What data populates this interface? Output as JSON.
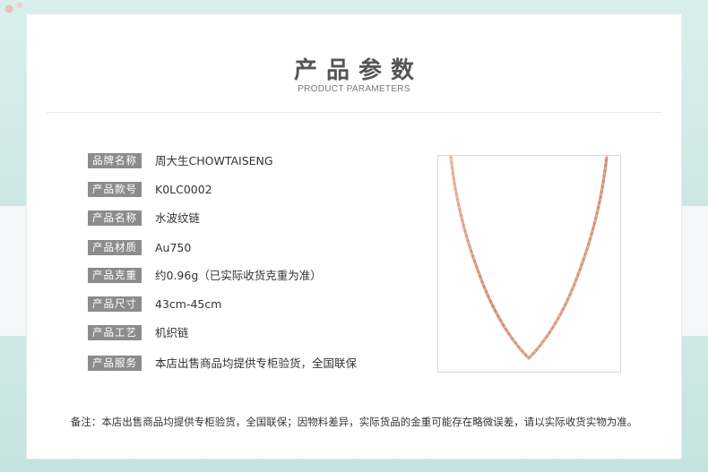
{
  "header": {
    "title_zh": "产品参数",
    "title_en": "PRODUCT PARAMETERS"
  },
  "params": [
    {
      "label": "品牌名称",
      "value": "周大生CHOWTAISENG"
    },
    {
      "label": "产品款号",
      "value": "K0LC0002"
    },
    {
      "label": "产品名称",
      "value": "水波纹链"
    },
    {
      "label": "产品材质",
      "value": "Au750"
    },
    {
      "label": "产品克重",
      "value": "约0.96g（已实际收货克重为准）"
    },
    {
      "label": "产品尺寸",
      "value": "43cm-45cm"
    },
    {
      "label": "产品工艺",
      "value": "机织链"
    },
    {
      "label": "产品服务",
      "value": "本店出售商品均提供专柜验货，全国联保"
    }
  ],
  "footnote": "备注：本店出售商品均提供专柜验货，全国联保；因物料差异，实际货品的金重可能存在略微误差，请以实际收货实物为准。",
  "colors": {
    "background_mint": "#cfe9e5",
    "label_bg": "#8c8c8c",
    "rose_gold": "#d9997c"
  },
  "product_image": {
    "icon": "rose-gold-chain-necklace"
  }
}
